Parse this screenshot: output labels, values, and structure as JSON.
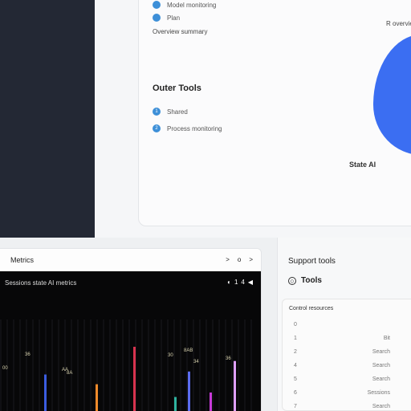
{
  "sidebar": {},
  "top_card": {
    "items_top": [
      {
        "label": "Model monitoring"
      },
      {
        "label": "Plan"
      }
    ],
    "meta": "Overview summary",
    "corner_label": "R overview",
    "section": {
      "title": "Outer Tools",
      "items": [
        {
          "num": "1",
          "label": "Shared"
        },
        {
          "num": "2",
          "label": "Process monitoring"
        }
      ]
    },
    "state_label": "State AI",
    "colors": {
      "blob": "#3b6ef2",
      "dot": "#3d8fd8"
    }
  },
  "metrics_panel": {
    "title": "Metrics",
    "header_icons": [
      ">",
      "o",
      ">"
    ],
    "chart_title": "Sessions state AI metrics",
    "chart_controls": [
      "◐",
      "1",
      "4",
      "◀"
    ],
    "chart_data": {
      "type": "bar",
      "series": [
        {
          "values": [
            6.8,
            1.8,
            5.5,
            10.5,
            1.6,
            3.8,
            7.2,
            4.4,
            8.6
          ]
        }
      ],
      "colors": [
        "#3b5de0",
        "#b24a2a",
        "#f08a2b",
        "#d7334f",
        "#3b7df0",
        "#2fb3a0",
        "#5b6cf0",
        "#c73ad8",
        "#e0a0ff"
      ],
      "annotations": [
        "36",
        "00",
        "AA",
        "8A",
        "30",
        "8AB",
        "34",
        "36"
      ],
      "ylim": [
        0,
        12
      ],
      "grid": false
    }
  },
  "right_panel": {
    "title": "Support tools",
    "tools_label": "Tools",
    "list_title": "Control resources",
    "items": [
      {
        "num": "0",
        "label": ""
      },
      {
        "num": "1",
        "label": "Bit"
      },
      {
        "num": "2",
        "label": "Search"
      },
      {
        "num": "4",
        "label": "Search"
      },
      {
        "num": "5",
        "label": "Search"
      },
      {
        "num": "6",
        "label": "Sessions"
      },
      {
        "num": "7",
        "label": "Search"
      }
    ]
  }
}
